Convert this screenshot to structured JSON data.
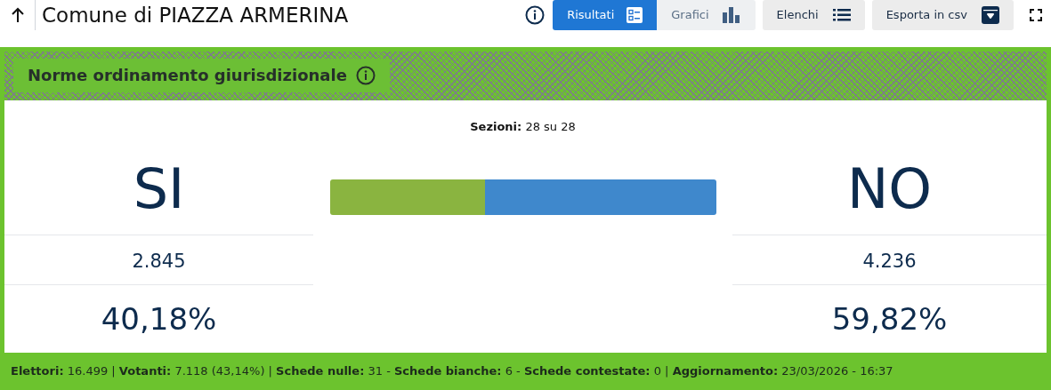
{
  "header": {
    "title": "Comune di PIAZZA ARMERINA"
  },
  "view_tabs": [
    {
      "label": "Risultati",
      "selected": true,
      "kind": "list"
    },
    {
      "label": "Grafici",
      "selected": false,
      "kind": "chart"
    }
  ],
  "buttons": [
    {
      "label": "Elenchi",
      "kind": "list"
    },
    {
      "label": "Esporta in csv",
      "kind": "download"
    }
  ],
  "referendum": {
    "title": "Norme ordinamento giurisdizionale",
    "sections": "**Sezioni:** 28 su 28",
    "options": [
      {
        "label": "SI",
        "votes": "2.845",
        "percent": "40,18%",
        "color": "#8ab440"
      },
      {
        "label": "NO",
        "votes": "4.236",
        "percent": "59,82%",
        "color": "#3f88cc"
      }
    ],
    "bar": {
      "level": 0.4018
    }
  },
  "status_bar": "**Elettori:** 16.499 | **Votanti:** 7.118 (43,14%) | **Schede nulle:** 31 - **Schede bianche:** 6 - **Schede contestate:** 0 | **Aggiornamento:** 23/03/2026 - 16:37"
}
